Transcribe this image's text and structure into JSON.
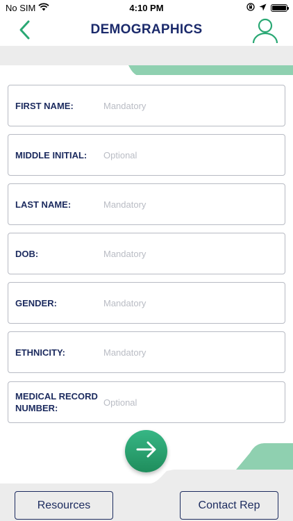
{
  "status_bar": {
    "carrier": "No SIM",
    "time": "4:10 PM"
  },
  "header": {
    "title": "DEMOGRAPHICS",
    "back_icon": "chevron-left-icon",
    "profile_icon": "user-icon"
  },
  "form": {
    "fields": [
      {
        "label": "FIRST NAME:",
        "placeholder": "Mandatory",
        "value": ""
      },
      {
        "label": "MIDDLE INITIAL:",
        "placeholder": "Optional",
        "value": ""
      },
      {
        "label": "LAST NAME:",
        "placeholder": "Mandatory",
        "value": ""
      },
      {
        "label": "DOB:",
        "placeholder": "Mandatory",
        "value": ""
      },
      {
        "label": "GENDER:",
        "placeholder": "Mandatory",
        "value": ""
      },
      {
        "label": "ETHNICITY:",
        "placeholder": "Mandatory",
        "value": ""
      },
      {
        "label": "MEDICAL RECORD NUMBER:",
        "placeholder": "Optional",
        "value": ""
      }
    ],
    "next_icon": "arrow-right-icon"
  },
  "footer": {
    "resources_label": "Resources",
    "contact_label": "Contact Rep"
  },
  "colors": {
    "accent": "#2aa874",
    "accent_light": "#8fd0b0",
    "navy": "#1b2a5e",
    "background": "#ececec"
  }
}
